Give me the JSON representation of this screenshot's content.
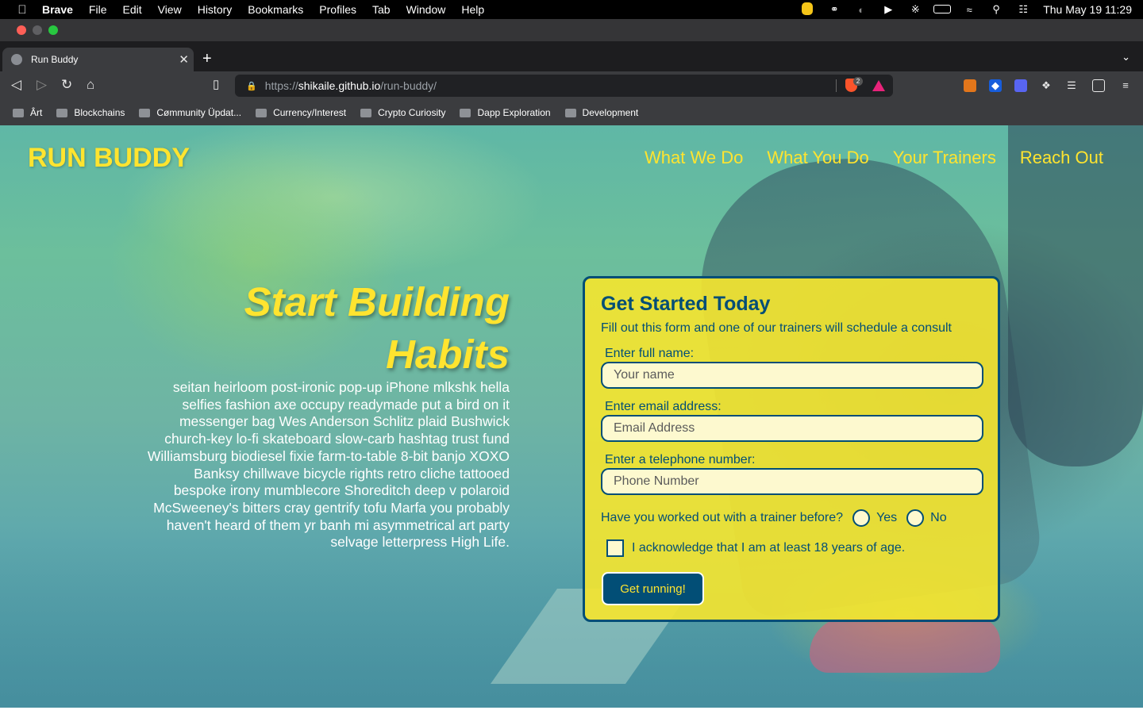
{
  "menubar": {
    "app_name": "Brave",
    "items": [
      "File",
      "Edit",
      "View",
      "History",
      "Bookmarks",
      "Profiles",
      "Tab",
      "Window",
      "Help"
    ],
    "clock": "Thu May 19  11:29"
  },
  "browser": {
    "tab_title": "Run Buddy",
    "url_scheme": "https://",
    "url_host": "shikaile.github.io",
    "url_path": "/run-buddy/",
    "shield_count": "2",
    "bookmarks": [
      "Ârt",
      "Blockchains",
      "Cømmunity Üpdat...",
      "Currency/Interest",
      "Crypto Curiosity",
      "Dapp Exploration",
      "Development"
    ]
  },
  "site": {
    "logo": "RUN BUDDY",
    "nav": [
      "What We Do",
      "What You Do",
      "Your Trainers",
      "Reach Out"
    ],
    "hero_title": "Start Building Habits",
    "hero_text": "seitan heirloom post-ironic pop-up iPhone mlkshk hella selfies fashion axe occupy readymade put a bird on it messenger bag Wes Anderson Schlitz plaid Bushwick church-key lo-fi skateboard slow-carb hashtag trust fund Williamsburg biodiesel fixie farm-to-table 8-bit banjo XOXO Banksy chillwave bicycle rights retro cliche tattooed bespoke irony mumblecore Shoreditch deep v polaroid McSweeney's bitters cray gentrify tofu Marfa you probably haven't heard of them yr banh mi asymmetrical art party selvage letterpress High Life."
  },
  "form": {
    "title": "Get Started Today",
    "subtitle": "Fill out this form and one of our trainers will schedule a consult",
    "name_label": "Enter full name:",
    "name_placeholder": "Your name",
    "email_label": "Enter email address:",
    "email_placeholder": "Email Address",
    "phone_label": "Enter a telephone number:",
    "phone_placeholder": "Phone Number",
    "trainer_question": "Have you worked out with a trainer before?",
    "yes_label": "Yes",
    "no_label": "No",
    "ack_label": "I acknowledge that I am at least 18 years of age.",
    "submit_label": "Get running!"
  },
  "colors": {
    "accent_yellow": "#ffe42f",
    "brand_blue": "#024e76"
  }
}
